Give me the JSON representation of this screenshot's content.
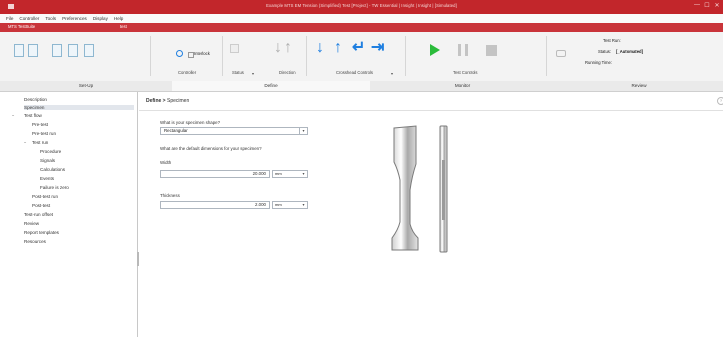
{
  "window": {
    "title": "Example MTS EM Tension (Simplified) Test [Project] - TW Essential | Insight | Insight | [Simulated]",
    "controls": [
      "—",
      "☐",
      "✕"
    ]
  },
  "menubar": {
    "items": [
      "File",
      "Controller",
      "Tools",
      "Preferences",
      "Display",
      "Help"
    ]
  },
  "app_tabs": {
    "app_name": "MTS TestSuite",
    "tab": "test"
  },
  "ribbon": {
    "groups": {
      "controller": "Controller",
      "status": "Status",
      "direction": "Direction",
      "crosshead": "Crosshead Controls",
      "test_controls": "Test Controls"
    },
    "interlock_label": "Interlock",
    "test_run": {
      "name_label": "Test Run:",
      "status_label": "Status:",
      "status_value": "[_Automated]",
      "time_label": "Running Time:"
    },
    "sections": [
      "Set-Up",
      "Define",
      "Monitor",
      "Review"
    ],
    "active_section": "Define",
    "accent": "#c2262b"
  },
  "sidebar": {
    "items": [
      {
        "label": "Description"
      },
      {
        "label": "Specimen"
      },
      {
        "label": "Test flow"
      },
      {
        "label": "Pre-test"
      },
      {
        "label": "Pre-test run"
      },
      {
        "label": "Test run"
      },
      {
        "label": "Procedure"
      },
      {
        "label": "Signals"
      },
      {
        "label": "Calculations"
      },
      {
        "label": "Events"
      },
      {
        "label": "Failure is zero"
      },
      {
        "label": "Post-test run"
      },
      {
        "label": "Post-test"
      },
      {
        "label": "Test-run offset"
      },
      {
        "label": "Review"
      },
      {
        "label": "Report templates"
      },
      {
        "label": "Resources"
      }
    ],
    "selected": "Specimen"
  },
  "main": {
    "breadcrumb": {
      "parent": "Define",
      "sep": ">",
      "current": "Specimen"
    },
    "shape_question": "What is your specimen shape?",
    "shape_value": "Rectangular",
    "dims_question": "What are the default dimensions for your specimen?",
    "width": {
      "label": "Width",
      "value": "20.000",
      "unit": "mm"
    },
    "thickness": {
      "label": "Thickness",
      "value": "2.000",
      "unit": "mm"
    },
    "help": "?"
  }
}
